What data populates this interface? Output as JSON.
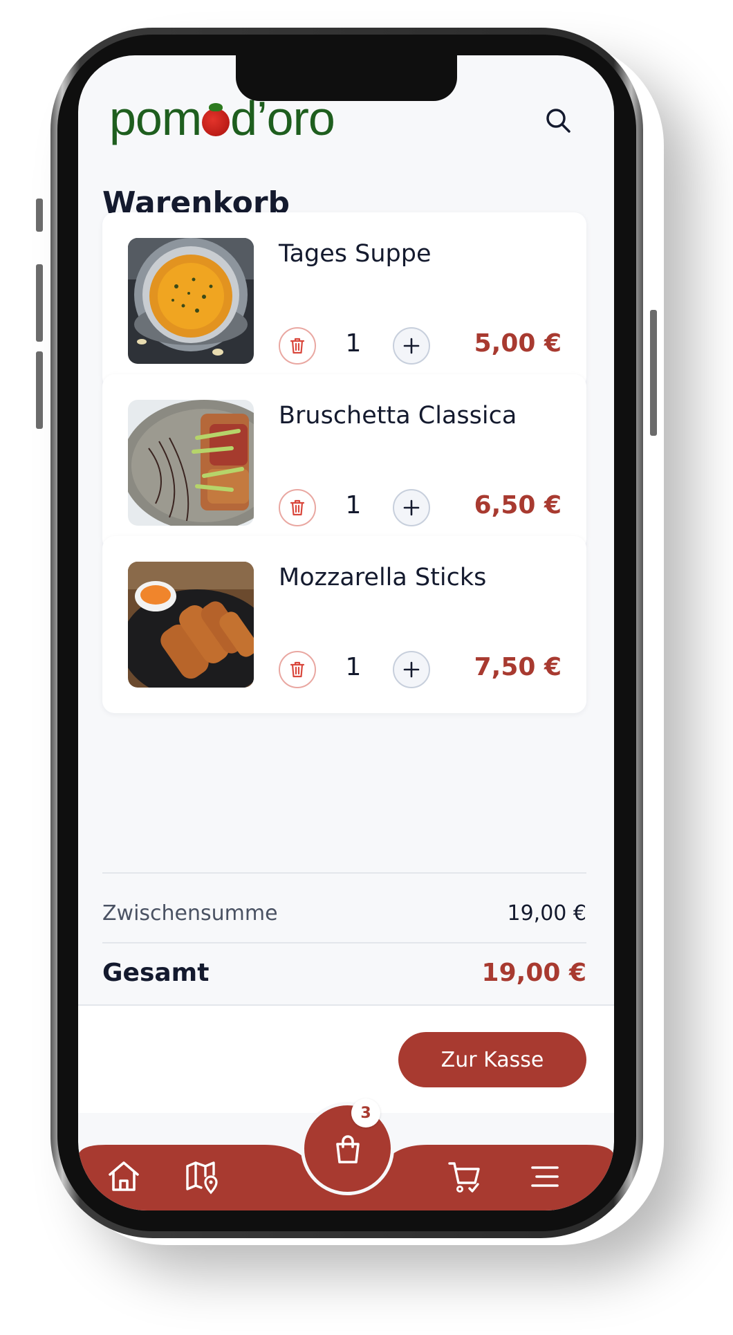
{
  "app": {
    "logo_text_left": "pom",
    "logo_text_right": "d’oro",
    "brand_color": "#a83a30",
    "logo_color": "#1e5e1e"
  },
  "header": {
    "search_icon": "search-icon"
  },
  "page": {
    "title": "Warenkorb"
  },
  "cart": {
    "items": [
      {
        "name": "Tages Suppe",
        "quantity": "1",
        "price": "5,00 €",
        "image": "soup"
      },
      {
        "name": "Bruschetta Classica",
        "quantity": "1",
        "price": "6,50 €",
        "image": "bruschetta"
      },
      {
        "name": "Mozzarella Sticks",
        "quantity": "1",
        "price": "7,50 €",
        "image": "mozzarella-sticks"
      }
    ],
    "item_icons": {
      "delete": "trash-icon",
      "increase": "plus-icon"
    }
  },
  "summary": {
    "subtotal_label": "Zwischensumme",
    "subtotal_value": "19,00 €",
    "total_label": "Gesamt",
    "total_value": "19,00 €"
  },
  "checkout": {
    "button_label": "Zur Kasse"
  },
  "bottom_nav": {
    "items": [
      "home-icon",
      "map-pin-icon",
      "shopping-bag-icon",
      "cart-check-icon",
      "menu-icon"
    ],
    "cart_badge_count": "3"
  }
}
